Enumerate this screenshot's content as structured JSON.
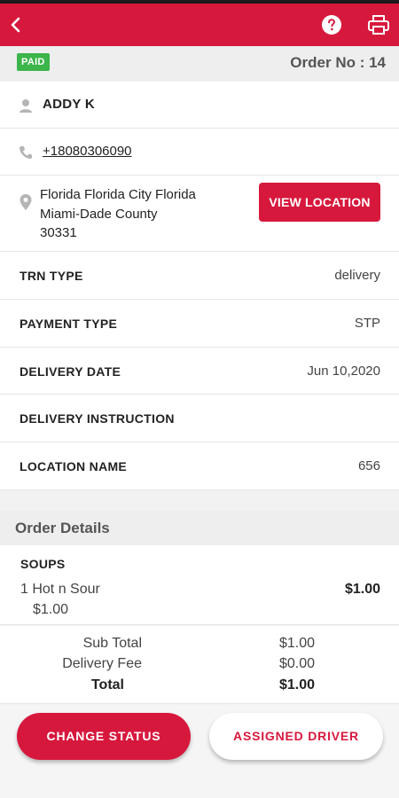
{
  "header": {
    "back_icon": "chevron-left-icon",
    "help_icon": "help-circle-icon",
    "print_icon": "printer-icon",
    "accent_color": "#d7183d"
  },
  "order": {
    "paid_badge": "PAID",
    "order_no": "Order No : 14",
    "badge_color": "#3cb54a"
  },
  "customer": {
    "name": "ADDY K",
    "phone": "+18080306090",
    "address_line1": "Florida Florida City Florida",
    "address_line2": "Miami-Dade County",
    "address_line3": "30331",
    "view_location_label": "VIEW LOCATION"
  },
  "details": [
    {
      "label": "TRN TYPE",
      "value": "delivery"
    },
    {
      "label": "PAYMENT TYPE",
      "value": "STP"
    },
    {
      "label": "DELIVERY DATE",
      "value": "Jun 10,2020"
    },
    {
      "label": "DELIVERY INSTRUCTION",
      "value": ""
    },
    {
      "label": "LOCATION NAME",
      "value": "656"
    }
  ],
  "order_details": {
    "section_title": "Order Details",
    "category": "SOUPS",
    "item_name": "1 Hot n Sour",
    "item_unit_price": "$1.00",
    "item_total": "$1.00"
  },
  "totals": {
    "subtotal_label": "Sub Total",
    "subtotal_value": "$1.00",
    "delivery_fee_label": "Delivery Fee",
    "delivery_fee_value": "$0.00",
    "total_label": "Total",
    "total_value": "$1.00"
  },
  "actions": {
    "change_status_label": "CHANGE STATUS",
    "assigned_driver_label": "ASSIGNED DRIVER"
  }
}
